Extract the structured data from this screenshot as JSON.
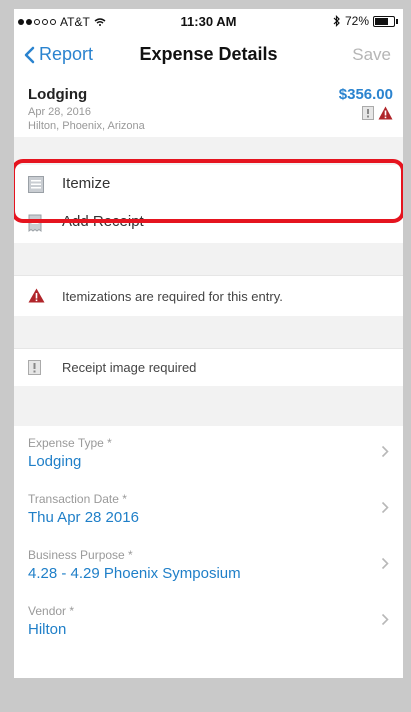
{
  "status": {
    "carrier": "AT&T",
    "time": "11:30 AM",
    "battery": "72%"
  },
  "nav": {
    "back_label": "Report",
    "title": "Expense Details",
    "save_label": "Save"
  },
  "entry": {
    "type": "Lodging",
    "date": "Apr 28, 2016",
    "location": "Hilton, Phoenix, Arizona",
    "amount": "$356.00"
  },
  "actions": {
    "itemize": "Itemize",
    "add_receipt": "Add Receipt"
  },
  "alerts": {
    "itemization": "Itemizations are required for this entry.",
    "receipt": "Receipt image required"
  },
  "fields": [
    {
      "label": "Expense Type *",
      "value": "Lodging"
    },
    {
      "label": "Transaction Date *",
      "value": "Thu Apr 28 2016"
    },
    {
      "label": "Business Purpose *",
      "value": "4.28 - 4.29 Phoenix Symposium"
    },
    {
      "label": "Vendor *",
      "value": "Hilton"
    }
  ],
  "colors": {
    "accent": "#2a83cf",
    "warning": "#b0252a",
    "highlight": "#e5141f"
  },
  "icons": [
    "back-chevron-icon",
    "wifi-icon",
    "bluetooth-icon",
    "battery-icon",
    "receipt-missing-icon",
    "warning-icon",
    "itemize-icon",
    "add-receipt-icon",
    "chevron-right-icon"
  ]
}
